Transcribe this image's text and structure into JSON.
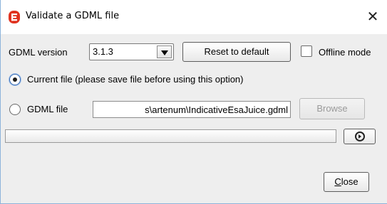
{
  "window": {
    "title": "Validate a GDML file",
    "close_glyph": "✕"
  },
  "gdml_version": {
    "label": "GDML version",
    "selected": "3.1.3"
  },
  "buttons": {
    "reset": "Reset to default",
    "browse": "Browse",
    "close_first": "C",
    "close_rest": "lose"
  },
  "offline_mode": {
    "label": "Offline mode",
    "checked": false
  },
  "options": {
    "current_file": "Current file (please save file before using this option)",
    "gdml_file": "GDML file"
  },
  "file_path": "s\\artenum\\IndicativeEsaJuice.gdml",
  "progress": {
    "value": 0
  },
  "icons": {
    "app": "app-logo-icon",
    "run": "play-circle-icon",
    "dropdown": "chevron-down-icon"
  },
  "colors": {
    "accent": "#3c6db2",
    "app_icon": "#e0321f"
  }
}
